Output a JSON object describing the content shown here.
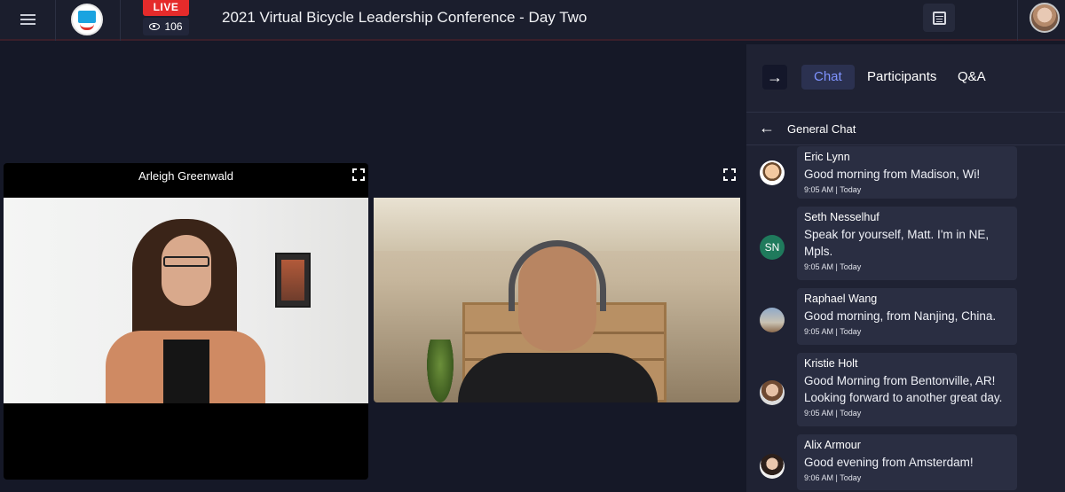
{
  "header": {
    "menu_icon": "hamburger-menu-icon",
    "logo_icon": "bike-logo-icon",
    "live_label": "LIVE",
    "viewer_count": "106",
    "title": "2021 Virtual Bicycle Leadership Conference - Day Two",
    "calendar_icon": "calendar-icon",
    "avatar_icon": "user-avatar"
  },
  "stage": {
    "tiles": [
      {
        "name": "Arleigh Greenwald"
      },
      {
        "name": ""
      }
    ]
  },
  "chat": {
    "tabs": [
      {
        "label": "Chat",
        "active": true
      },
      {
        "label": "Participants",
        "active": false
      },
      {
        "label": "Q&A",
        "active": false
      }
    ],
    "header_title": "General Chat",
    "messages": [
      {
        "author": "Eric Lynn",
        "text": "Good morning from Madison, Wi!",
        "time": "9:05 AM | Today",
        "avatar": "cartoon-avatar",
        "initials": ""
      },
      {
        "author": "Seth Nesselhuf",
        "text": "Speak for yourself, Matt. I'm in NE, Mpls.",
        "time": "9:05 AM | Today",
        "avatar": "initials-avatar",
        "initials": "SN"
      },
      {
        "author": "Raphael Wang",
        "text": "Good morning, from Nanjing, China.",
        "time": "9:05 AM | Today",
        "avatar": "photo-avatar",
        "initials": ""
      },
      {
        "author": "Kristie Holt",
        "text": "Good Morning from Bentonville, AR! Looking forward to another great day.",
        "time": "9:05 AM | Today",
        "avatar": "photo-avatar",
        "initials": ""
      },
      {
        "author": "Alix Armour",
        "text": "Good evening from Amsterdam!",
        "time": "9:06 AM | Today",
        "avatar": "photo-avatar",
        "initials": ""
      }
    ]
  },
  "colors": {
    "accent": "#7f93ff",
    "live": "#e52b2b",
    "background": "#151827",
    "panel": "#1f2233",
    "bubble": "#2a2e42",
    "initials_avatar": "#1f7a5c"
  }
}
